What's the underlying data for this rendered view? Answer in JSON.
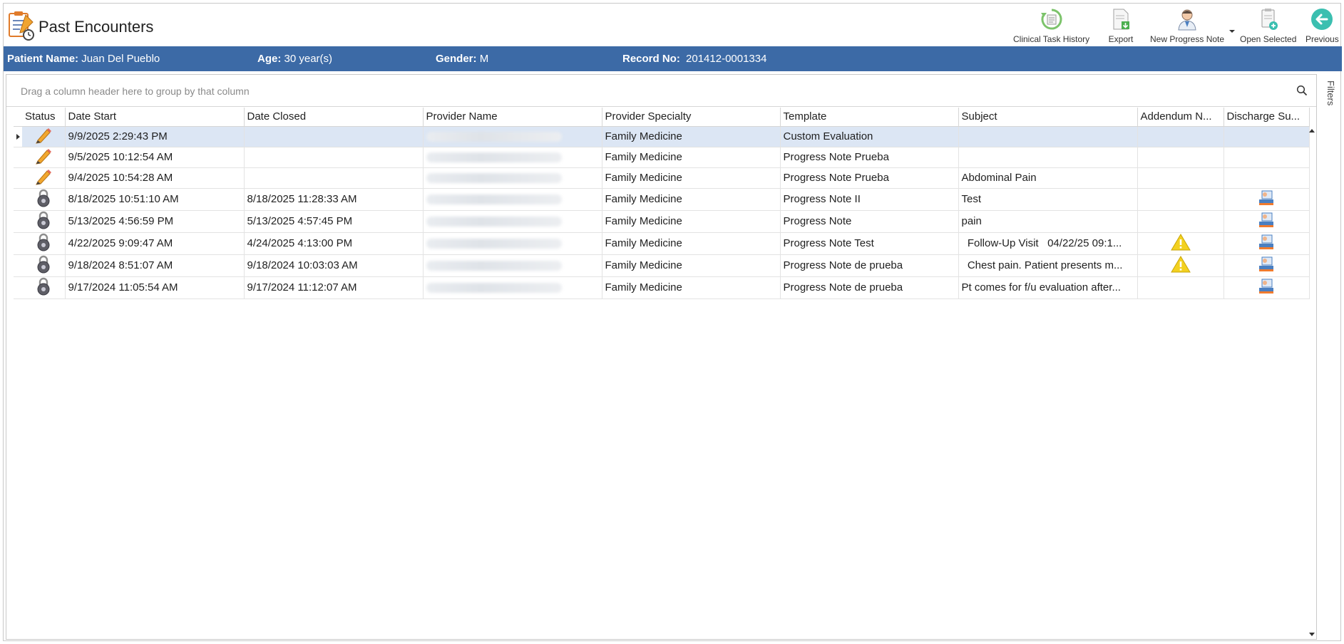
{
  "page": {
    "title": "Past Encounters"
  },
  "toolbar": {
    "clinical_task_history": "Clinical Task History",
    "export": "Export",
    "new_progress_note": "New Progress Note",
    "open_selected": "Open Selected",
    "previous": "Previous"
  },
  "patient": {
    "name_label": "Patient Name:",
    "name": "Juan Del Pueblo",
    "age_label": "Age:",
    "age": "30 year(s)",
    "gender_label": "Gender:",
    "gender": "M",
    "record_label": "Record No:",
    "record_no": "201412-0001334"
  },
  "grid": {
    "group_hint": "Drag a column header here to group by that column",
    "side_panel_label": "Filters",
    "columns": [
      "Status",
      "Date Start",
      "Date Closed",
      "Provider Name",
      "Provider Specialty",
      "Template",
      "Subject",
      "Addendum N...",
      "Discharge Su..."
    ],
    "rows": [
      {
        "status": "open-pencil",
        "date_start": "9/9/2025 2:29:43 PM",
        "date_closed": "",
        "specialty": "Family Medicine",
        "template": "Custom Evaluation",
        "subject": "",
        "addendum": false,
        "discharge": false
      },
      {
        "status": "open-pencil",
        "date_start": "9/5/2025 10:12:54 AM",
        "date_closed": "",
        "specialty": "Family Medicine",
        "template": "Progress Note Prueba",
        "subject": "",
        "addendum": false,
        "discharge": false
      },
      {
        "status": "open-pencil",
        "date_start": "9/4/2025 10:54:28 AM",
        "date_closed": "",
        "specialty": "Family Medicine",
        "template": "Progress Note Prueba",
        "subject": "Abdominal Pain",
        "addendum": false,
        "discharge": false
      },
      {
        "status": "closed-lock",
        "date_start": "8/18/2025 10:51:10 AM",
        "date_closed": "8/18/2025 11:28:33 AM",
        "specialty": "Family Medicine",
        "template": "Progress Note II",
        "subject": "Test",
        "addendum": false,
        "discharge": true
      },
      {
        "status": "closed-lock",
        "date_start": "5/13/2025 4:56:59 PM",
        "date_closed": "5/13/2025 4:57:45 PM",
        "specialty": "Family Medicine",
        "template": "Progress Note",
        "subject": "pain",
        "addendum": false,
        "discharge": true
      },
      {
        "status": "closed-lock",
        "date_start": "4/22/2025 9:09:47 AM",
        "date_closed": "4/24/2025 4:13:00 PM",
        "specialty": "Family Medicine",
        "template": "Progress Note Test",
        "subject": "  Follow-Up Visit   04/22/25 09:1...",
        "addendum": true,
        "discharge": true
      },
      {
        "status": "closed-lock",
        "date_start": "9/18/2024 8:51:07 AM",
        "date_closed": "9/18/2024 10:03:03 AM",
        "specialty": "Family Medicine",
        "template": "Progress Note de prueba",
        "subject": "  Chest pain. Patient presents m...",
        "addendum": true,
        "discharge": true
      },
      {
        "status": "closed-lock",
        "date_start": "9/17/2024 11:05:54 AM",
        "date_closed": "9/17/2024 11:12:07 AM",
        "specialty": "Family Medicine",
        "template": "Progress Note de prueba",
        "subject": "Pt comes for f/u evaluation after...",
        "addendum": false,
        "discharge": true
      }
    ]
  },
  "colors": {
    "banner": "#3c6aa6",
    "selected_row": "#dce6f4",
    "accent_teal": "#3bbfb0"
  }
}
